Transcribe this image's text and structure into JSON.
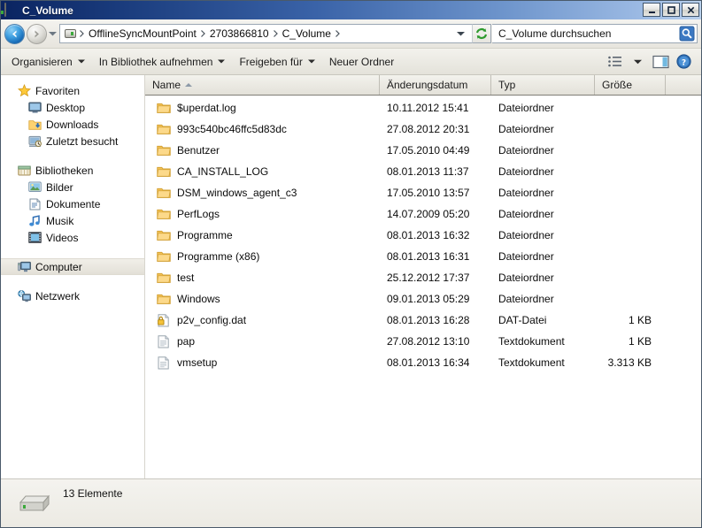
{
  "window": {
    "title": "C_Volume",
    "icon": "drive-icon",
    "controls": {
      "minimize": "minimize-button",
      "maximize": "maximize-button",
      "close": "close-button"
    }
  },
  "address_bar": {
    "back_label": "Zurück",
    "forward_label": "Vorwärts",
    "history_label": "Zuletzt besuchte Seiten",
    "breadcrumb": [
      "OfflineSyncMountPoint",
      "2703866810",
      "C_Volume"
    ],
    "refresh_label": "Aktualisieren",
    "search": {
      "value": "C_Volume durchsuchen",
      "placeholder": "C_Volume durchsuchen"
    }
  },
  "command_bar": {
    "items": [
      {
        "label": "Organisieren",
        "has_caret": true
      },
      {
        "label": "In Bibliothek aufnehmen",
        "has_caret": true
      },
      {
        "label": "Freigeben für",
        "has_caret": true
      },
      {
        "label": "Neuer Ordner",
        "has_caret": false
      }
    ],
    "view_label": "Ansicht ändern",
    "preview_label": "Vorschaufenster",
    "help_label": "Hilfe"
  },
  "sidebar": {
    "groups": [
      {
        "header": {
          "label": "Favoriten",
          "icon": "star-icon"
        },
        "items": [
          {
            "label": "Desktop",
            "icon": "desktop-icon"
          },
          {
            "label": "Downloads",
            "icon": "downloads-icon"
          },
          {
            "label": "Zuletzt besucht",
            "icon": "recent-icon"
          }
        ]
      },
      {
        "header": {
          "label": "Bibliotheken",
          "icon": "libraries-icon"
        },
        "items": [
          {
            "label": "Bilder",
            "icon": "pictures-icon"
          },
          {
            "label": "Dokumente",
            "icon": "documents-icon"
          },
          {
            "label": "Musik",
            "icon": "music-icon"
          },
          {
            "label": "Videos",
            "icon": "videos-icon"
          }
        ]
      },
      {
        "header": {
          "label": "Computer",
          "icon": "computer-icon",
          "selected": true
        },
        "items": []
      },
      {
        "header": {
          "label": "Netzwerk",
          "icon": "network-icon"
        },
        "items": []
      }
    ]
  },
  "file_list": {
    "columns": [
      {
        "label": "Name",
        "sorted": "asc"
      },
      {
        "label": "Änderungsdatum",
        "sorted": ""
      },
      {
        "label": "Typ",
        "sorted": ""
      },
      {
        "label": "Größe",
        "sorted": ""
      }
    ],
    "rows": [
      {
        "name": "$uperdat.log",
        "date": "10.11.2012 15:41",
        "type": "Dateiordner",
        "size": "",
        "icon": "folder-icon"
      },
      {
        "name": "993c540bc46ffc5d83dc",
        "date": "27.08.2012 20:31",
        "type": "Dateiordner",
        "size": "",
        "icon": "folder-icon"
      },
      {
        "name": "Benutzer",
        "date": "17.05.2010 04:49",
        "type": "Dateiordner",
        "size": "",
        "icon": "folder-icon"
      },
      {
        "name": "CA_INSTALL_LOG",
        "date": "08.01.2013 11:37",
        "type": "Dateiordner",
        "size": "",
        "icon": "folder-icon"
      },
      {
        "name": "DSM_windows_agent_c3",
        "date": "17.05.2010 13:57",
        "type": "Dateiordner",
        "size": "",
        "icon": "folder-icon"
      },
      {
        "name": "PerfLogs",
        "date": "14.07.2009 05:20",
        "type": "Dateiordner",
        "size": "",
        "icon": "folder-icon"
      },
      {
        "name": "Programme",
        "date": "08.01.2013 16:32",
        "type": "Dateiordner",
        "size": "",
        "icon": "folder-icon"
      },
      {
        "name": "Programme (x86)",
        "date": "08.01.2013 16:31",
        "type": "Dateiordner",
        "size": "",
        "icon": "folder-icon"
      },
      {
        "name": "test",
        "date": "25.12.2012 17:37",
        "type": "Dateiordner",
        "size": "",
        "icon": "folder-icon"
      },
      {
        "name": "Windows",
        "date": "09.01.2013 05:29",
        "type": "Dateiordner",
        "size": "",
        "icon": "folder-icon"
      },
      {
        "name": "p2v_config.dat",
        "date": "08.01.2013 16:28",
        "type": "DAT-Datei",
        "size": "1 KB",
        "icon": "locked-file-icon"
      },
      {
        "name": "pap",
        "date": "27.08.2012 13:10",
        "type": "Textdokument",
        "size": "1 KB",
        "icon": "text-file-icon"
      },
      {
        "name": "vmsetup",
        "date": "08.01.2013 16:34",
        "type": "Textdokument",
        "size": "3.313 KB",
        "icon": "text-file-icon"
      }
    ]
  },
  "status_bar": {
    "icon": "drive-icon",
    "text": "13 Elemente"
  },
  "colors": {
    "title_left": "#0a2461",
    "title_right": "#b9d0ec",
    "chrome": "#eae8e1",
    "folder": "#fcd271",
    "selection": "#e8e5dc"
  }
}
